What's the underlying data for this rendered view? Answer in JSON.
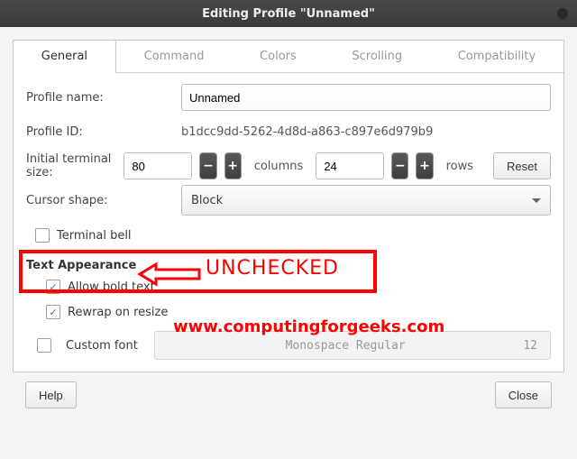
{
  "title": "Editing Profile \"Unnamed\"",
  "tabs": {
    "general": "General",
    "command": "Command",
    "colors": "Colors",
    "scrolling": "Scrolling",
    "compatibility": "Compatibility"
  },
  "labels": {
    "profile_name": "Profile name:",
    "profile_id": "Profile ID:",
    "initial_size": "Initial terminal size:",
    "columns": "columns",
    "rows": "rows",
    "reset": "Reset",
    "cursor_shape": "Cursor shape:",
    "terminal_bell": "Terminal bell",
    "text_appearance": "Text Appearance",
    "allow_bold": "Allow bold text",
    "rewrap": "Rewrap on resize",
    "custom_font": "Custom font",
    "help": "Help",
    "close": "Close"
  },
  "values": {
    "profile_name": "Unnamed",
    "profile_id": "b1dcc9dd-5262-4d8d-a863-c897e6d979b9",
    "cols": "80",
    "rows": "24",
    "cursor_shape": "Block",
    "font_name": "Monospace Regular",
    "font_size": "12"
  },
  "annotation": {
    "text": "UNCHECKED",
    "watermark": "www.computingforgeeks.com"
  }
}
